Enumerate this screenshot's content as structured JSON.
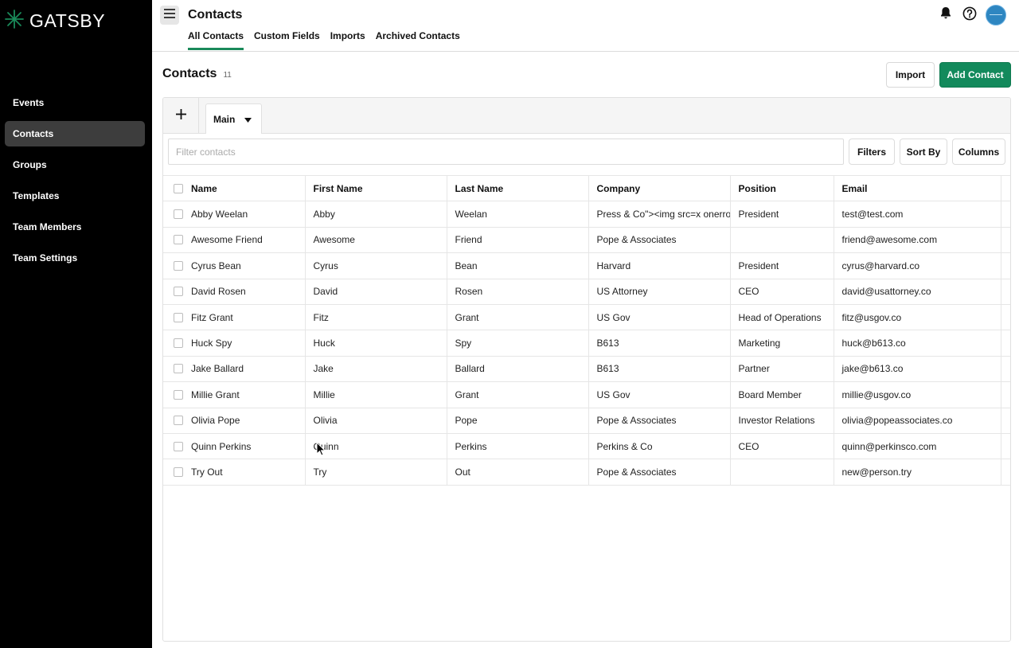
{
  "brand": {
    "name": "GATSBY",
    "logo_color": "#1a8a5a"
  },
  "sidebar": {
    "items": [
      {
        "label": "Events",
        "active": false
      },
      {
        "label": "Contacts",
        "active": true
      },
      {
        "label": "Groups",
        "active": false
      },
      {
        "label": "Templates",
        "active": false
      },
      {
        "label": "Team Members",
        "active": false
      },
      {
        "label": "Team Settings",
        "active": false
      }
    ]
  },
  "header": {
    "title": "Contacts",
    "tabs": [
      {
        "label": "All Contacts",
        "active": true
      },
      {
        "label": "Custom Fields",
        "active": false
      },
      {
        "label": "Imports",
        "active": false
      },
      {
        "label": "Archived Contacts",
        "active": false
      }
    ],
    "icons": [
      "hamburger-menu-icon",
      "bell-icon",
      "help-icon",
      "user-avatar"
    ]
  },
  "main": {
    "heading": "Contacts",
    "count": "11",
    "import_label": "Import",
    "add_label": "Add Contact",
    "accent_color": "#138a5c",
    "view_tab": "Main",
    "filter": {
      "placeholder": "Filter contacts",
      "value": ""
    },
    "filters_label": "Filters",
    "sort_label": "Sort By",
    "columns_label": "Columns",
    "table": {
      "headers": [
        "Name",
        "First Name",
        "Last Name",
        "Company",
        "Position",
        "Email"
      ],
      "rows": [
        [
          "Abby Weelan",
          "Abby",
          "Weelan",
          "Press & Co\"><img src=x onerror=",
          "President",
          "test@test.com"
        ],
        [
          "Awesome Friend",
          "Awesome",
          "Friend",
          "Pope & Associates",
          "",
          "friend@awesome.com"
        ],
        [
          "Cyrus Bean",
          "Cyrus",
          "Bean",
          "Harvard",
          "President",
          "cyrus@harvard.co"
        ],
        [
          "David Rosen",
          "David",
          "Rosen",
          "US Attorney",
          "CEO",
          "david@usattorney.co"
        ],
        [
          "Fitz Grant",
          "Fitz",
          "Grant",
          "US Gov",
          "Head of Operations",
          "fitz@usgov.co"
        ],
        [
          "Huck Spy",
          "Huck",
          "Spy",
          "B613",
          "Marketing",
          "huck@b613.co"
        ],
        [
          "Jake Ballard",
          "Jake",
          "Ballard",
          "B613",
          "Partner",
          "jake@b613.co"
        ],
        [
          "Millie Grant",
          "Millie",
          "Grant",
          "US Gov",
          "Board Member",
          "millie@usgov.co"
        ],
        [
          "Olivia Pope",
          "Olivia",
          "Pope",
          "Pope & Associates",
          "Investor Relations",
          "olivia@popeassociates.co"
        ],
        [
          "Quinn Perkins",
          "Quinn",
          "Perkins",
          "Perkins & Co",
          "CEO",
          "quinn@perkinsco.com"
        ],
        [
          "Try Out",
          "Try",
          "Out",
          "Pope & Associates",
          "",
          "new@person.try"
        ]
      ]
    }
  }
}
